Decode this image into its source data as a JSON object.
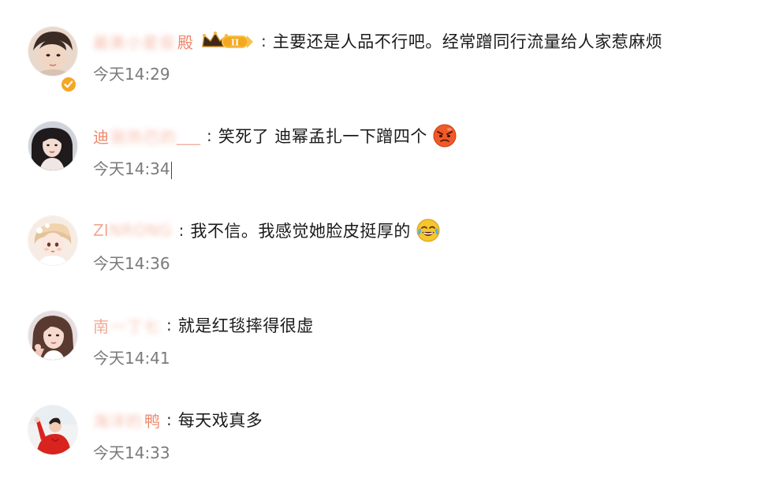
{
  "comments": [
    {
      "username_visible": "殿",
      "username_hidden": "最美小星俊",
      "text": "主要还是人品不行吧。经常蹭同行流量给人家惹麻烦",
      "time": "今天14:29",
      "badge": "II",
      "emoji": null,
      "verified": true,
      "avatar": "avatar-boy-portrait"
    },
    {
      "username_visible": "迪",
      "username_hidden": "丽热巴的",
      "username_tail": "___",
      "text": "笑死了 迪幂孟扎一下蹭四个",
      "time": "今天14:34",
      "emoji": "angry-face-emoji",
      "avatar": "avatar-woman-dark-hair"
    },
    {
      "username_visible": "ZI",
      "username_hidden": "NRONG",
      "text": "我不信。我感觉她脸皮挺厚的",
      "time": "今天14:36",
      "emoji": "laughing-crying-emoji",
      "avatar": "avatar-cartoon-girl"
    },
    {
      "username_visible": "南",
      "username_hidden": "一丁七",
      "text": "就是红毯摔得很虚",
      "time": "今天14:41",
      "emoji": null,
      "avatar": "avatar-woman-selfie"
    },
    {
      "username_visible": "鸭",
      "username_hidden": "海洋的",
      "text": "每天戏真多",
      "time": "今天14:33",
      "emoji": null,
      "avatar": "avatar-person-red"
    }
  ],
  "colors": {
    "username": "#eb7350",
    "text": "#1a1a1a",
    "time": "#7a7a7a",
    "verified": "#f6a623"
  }
}
